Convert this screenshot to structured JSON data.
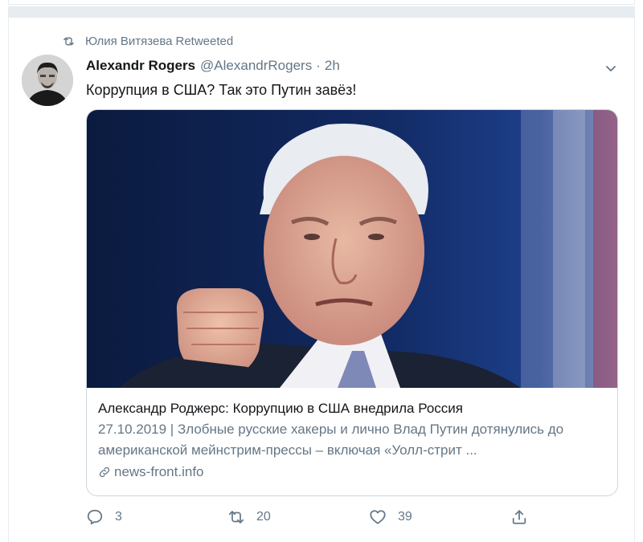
{
  "retweet_context": {
    "name": "Юлия Витязева",
    "suffix": "Retweeted"
  },
  "tweet": {
    "author_name": "Alexandr Rogers",
    "author_handle": "@AlexandrRogers",
    "separator": "·",
    "timestamp": "2h",
    "text": "Коррупция в США? Так это Путин завёз!"
  },
  "card": {
    "title": "Александр Роджерс: Коррупцию в США внедрила Россия",
    "description": "27.10.2019 | Злобные русские хакеры и лично Влад Путин дотянулись до американской мейнстрим-прессы – включая «Уолл-стрит ...",
    "domain": "news-front.info"
  },
  "actions": {
    "reply_count": "3",
    "retweet_count": "20",
    "like_count": "39"
  },
  "icons": {
    "retweet_context": "retweet-icon",
    "caret": "chevron-down-icon",
    "link": "link-icon",
    "reply": "reply-icon",
    "retweet": "retweet-icon",
    "like": "heart-icon",
    "share": "share-icon"
  },
  "colors": {
    "secondary_text": "#657786",
    "border": "#ccd6dd",
    "separator_bg": "#e6ecf0"
  }
}
